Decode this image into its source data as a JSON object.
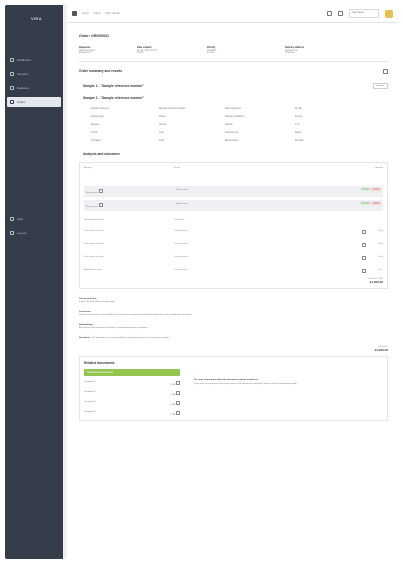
{
  "app": {
    "logo": "VIRA"
  },
  "sidebar": {
    "items": [
      {
        "label": "Dashboard",
        "icon": "dashboard-icon",
        "active": false
      },
      {
        "label": "Samples",
        "icon": "flask-icon",
        "active": false
      },
      {
        "label": "Requests",
        "icon": "list-icon",
        "active": false
      },
      {
        "label": "Orders",
        "icon": "document-icon",
        "active": true
      }
    ],
    "bottom_items": [
      {
        "label": "Help",
        "icon": "help-icon"
      },
      {
        "label": "Log out",
        "icon": "logout-icon"
      }
    ]
  },
  "topbar": {
    "crumbs": [
      "Home",
      "Orders",
      "Order details"
    ],
    "user": "User name"
  },
  "order": {
    "title": "Order: ORD00001",
    "summary": [
      {
        "key": "Requester",
        "values": [
          "Name Surname",
          "Department"
        ]
      },
      {
        "key": "Date created",
        "values": [
          "01 Jan 2024, 10:00",
          "Status"
        ]
      },
      {
        "key": "Priority",
        "values": [
          "Standard",
          "Invoice"
        ]
      },
      {
        "key": "Delivery address",
        "values": [
          "Address line",
          "Postcode"
        ]
      }
    ]
  },
  "order_summary": {
    "title": "Order summary and results",
    "sample1": "Sample 1 - \"Sample reference number\"",
    "sample1_pill": "Expand",
    "sample2": "Sample 2 - \"Sample reference number\"",
    "details": [
      "Sample reference",
      "Sample reference number",
      "Date registered",
      "01 Jan",
      "Sample type",
      "Tissue",
      "Storage conditions",
      "Frozen",
      "Species",
      "Human",
      "Volume",
      "1 ml",
      "Tissue",
      "Liver",
      "Analysis type",
      "Panel",
      "Container",
      "Tube",
      "Result status",
      "Pending"
    ]
  },
  "results": {
    "title": "Analysis and outcomes",
    "col1": "Analysis",
    "col2": "Result",
    "col3": "Outcome",
    "rows": [
      {
        "a": "Assay name",
        "b": "Result value",
        "c": "Passed",
        "d": "Failed"
      },
      {
        "a": "Assay name",
        "b": "Result value",
        "c": "Passed",
        "d": "Failed"
      }
    ],
    "section2_col1": "Recommended tests",
    "section2_col2": "Comments",
    "lines": [
      {
        "a": "Test name and code",
        "b": "Comment text",
        "c": "Price"
      },
      {
        "a": "Test name and code",
        "b": "Comment text",
        "c": "Price"
      },
      {
        "a": "Test name and code",
        "b": "Comment text",
        "c": "Price"
      },
      {
        "a": "Additional services",
        "b": "Comment text",
        "c": "Price"
      }
    ],
    "subtotal_label": "Total (excl. VAT)",
    "subtotal_value": "£1,000.00"
  },
  "notes": {
    "p1_title": "Turnaround time:",
    "p1": "5 days. Results will be sent by email.",
    "p2_title": "Comments:",
    "p2": "Please note that the results provided are for research purposes only and should not be used for diagnostic decisions.",
    "p3_title": "Methodology:",
    "p3": "All samples are processed according to standard operating procedures.",
    "p4_title": "Disclaimer:",
    "p4": "The laboratory is not responsible for sample quality issues arising before receipt.",
    "total_label": "Total price",
    "total_value": "£1,200.00"
  },
  "documents": {
    "title": "Related documents",
    "button": "Download all documents",
    "items": [
      {
        "name": "Document 1",
        "size": "1 MB"
      },
      {
        "name": "Document 2",
        "size": "1 MB"
      },
      {
        "name": "Document 3",
        "size": "1 MB"
      },
      {
        "name": "Document 4",
        "size": "1 MB"
      }
    ],
    "info_title": "For more information about the documents please contact us",
    "info": "If you have any questions about your order or the documents attached, please contact the laboratory team."
  }
}
